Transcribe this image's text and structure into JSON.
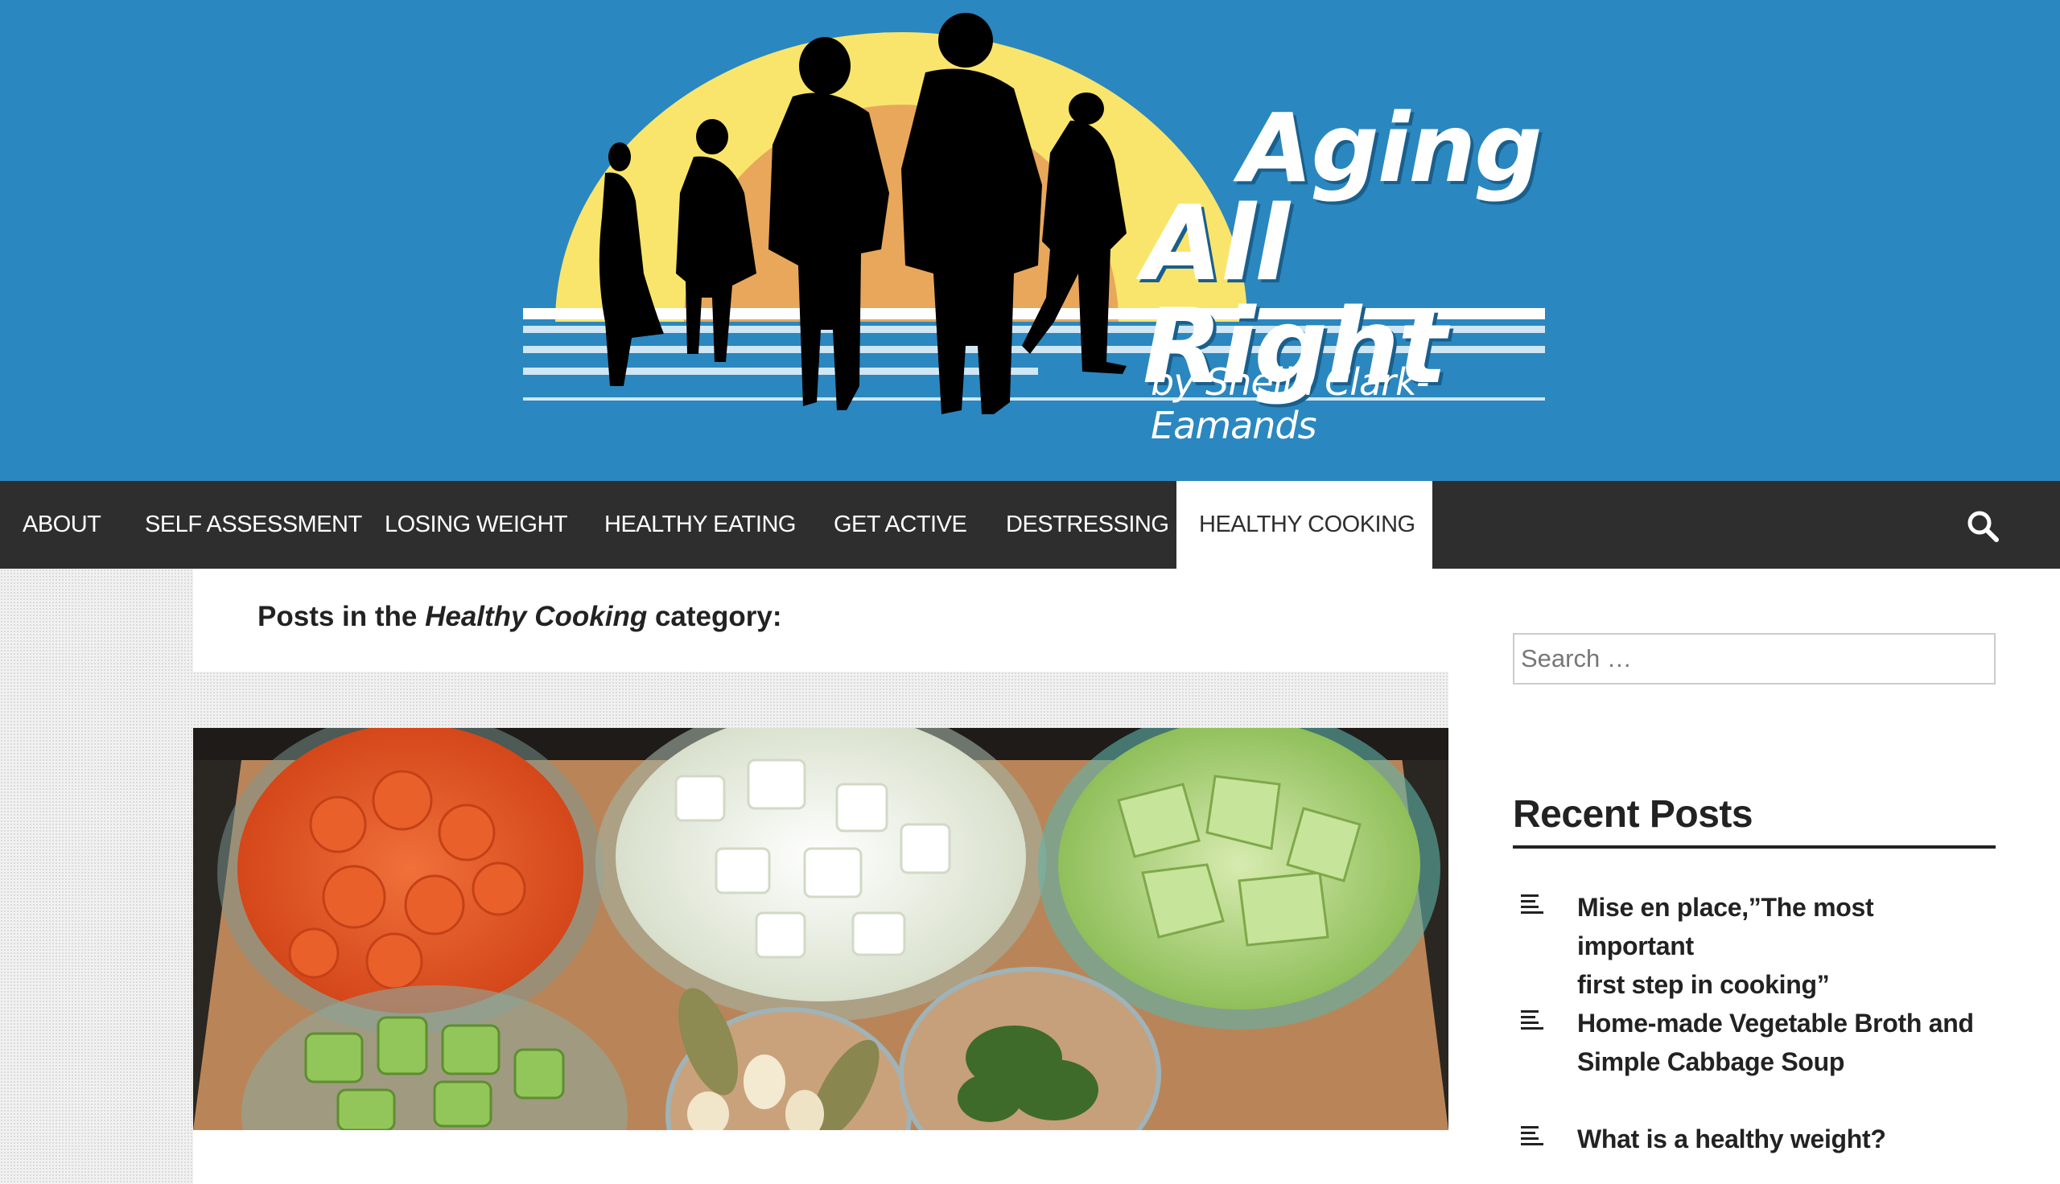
{
  "site": {
    "title_line1": "Aging",
    "title_line2": "All Right",
    "byline": "by Sheila Clark-Eamands"
  },
  "nav": {
    "items": [
      {
        "label": "ABOUT"
      },
      {
        "label": "SELF ASSESSMENT"
      },
      {
        "label": "LOSING WEIGHT"
      },
      {
        "label": "HEALTHY EATING"
      },
      {
        "label": "GET ACTIVE"
      },
      {
        "label": "DESTRESSING"
      },
      {
        "label": "HEALTHY COOKING"
      }
    ],
    "active_index": 6,
    "search_icon": "search-icon"
  },
  "archive": {
    "prefix": "Posts in the ",
    "category": "Healthy Cooking",
    "suffix": " category:"
  },
  "sidebar": {
    "search_placeholder": "Search …",
    "recent_title": "Recent Posts",
    "recent_posts": [
      {
        "line1": "Mise en place,”The most important",
        "line2": "first step in cooking”"
      },
      {
        "line1": "Home-made Vegetable Broth and",
        "line2": "Simple Cabbage Soup"
      },
      {
        "line1": "What is a healthy weight?",
        "line2": ""
      }
    ],
    "post_icon": "text-lines-icon"
  },
  "colors": {
    "header_bg": "#2b87bf",
    "nav_bg": "#2e2e2e",
    "sun_outer": "#f9e56b",
    "sun_inner": "#e8a75a",
    "text_dark": "#222222"
  }
}
